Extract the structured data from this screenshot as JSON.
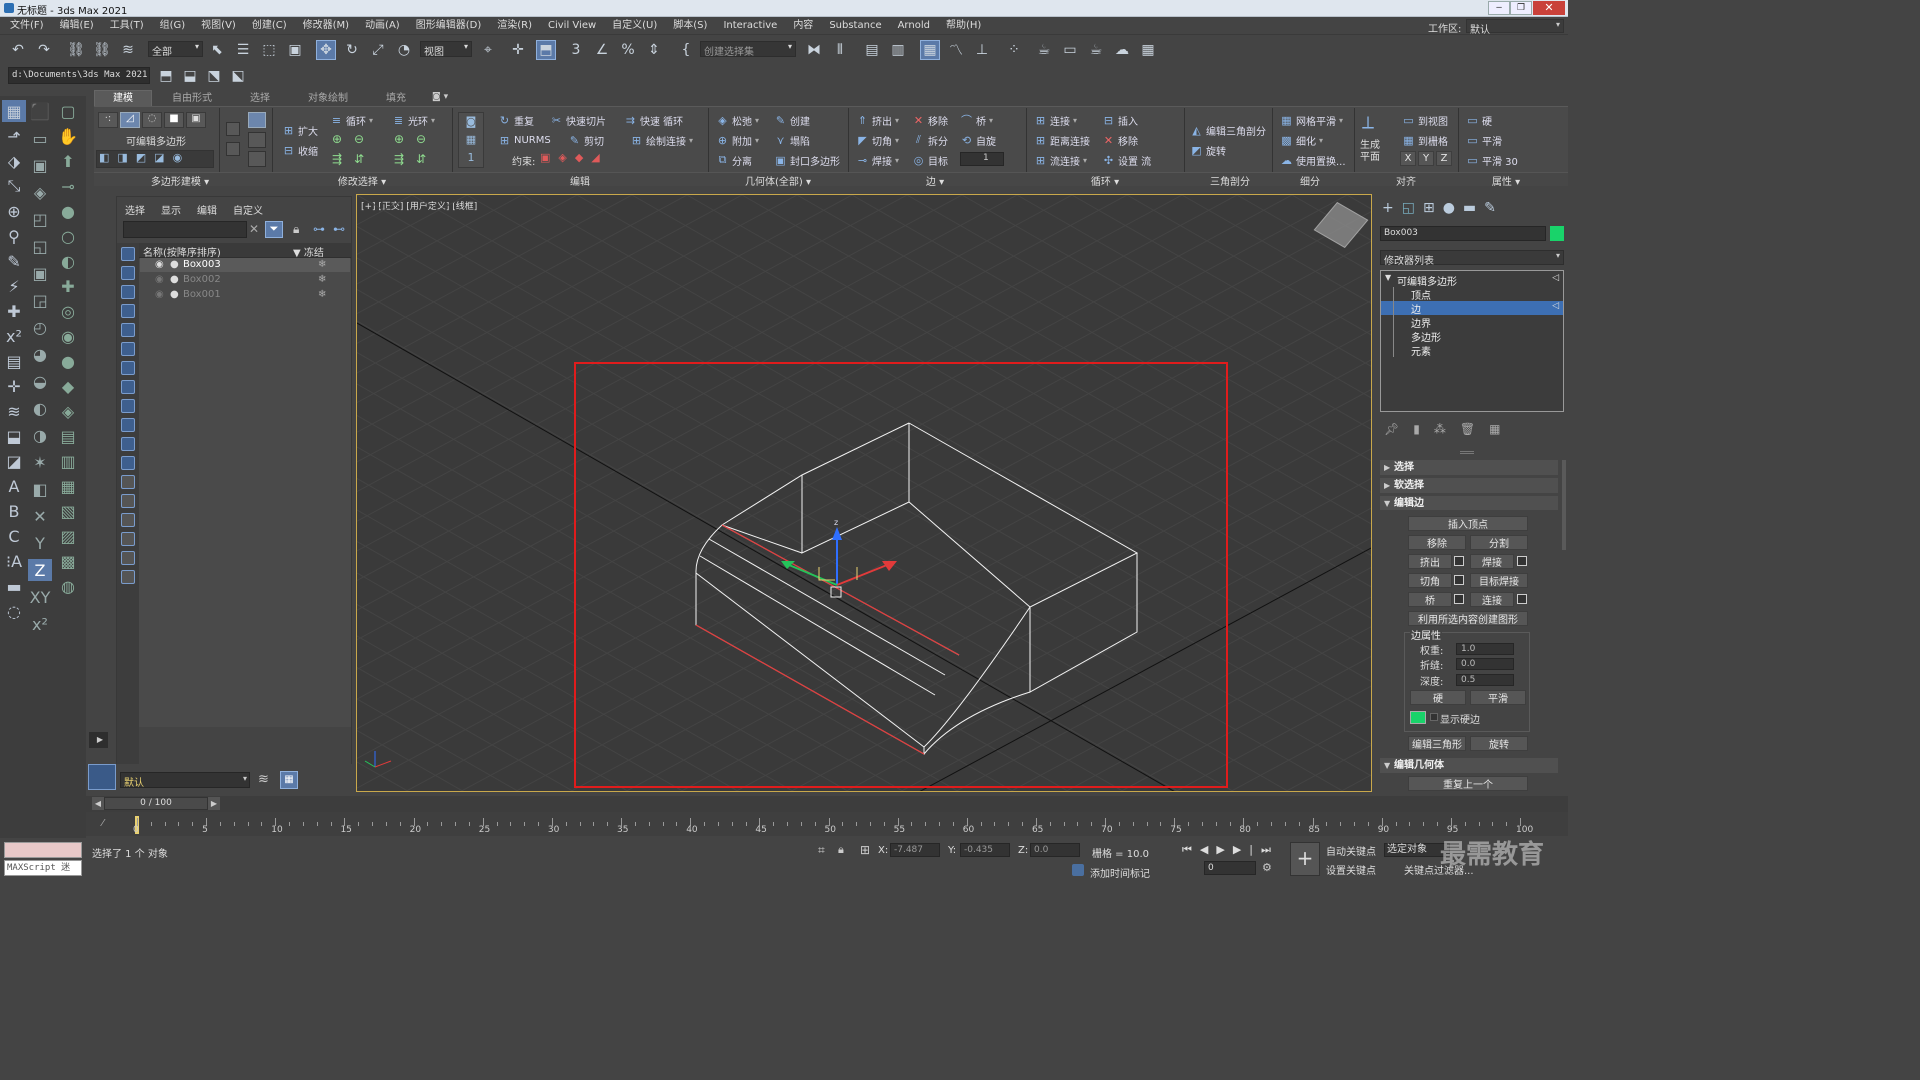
{
  "window": {
    "title": "无标题 - 3ds Max 2021"
  },
  "menu": [
    "文件(F)",
    "编辑(E)",
    "工具(T)",
    "组(G)",
    "视图(V)",
    "创建(C)",
    "修改器(M)",
    "动画(A)",
    "图形编辑器(D)",
    "渲染(R)",
    "Civil View",
    "自定义(U)",
    "脚本(S)",
    "Interactive",
    "内容",
    "Substance",
    "Arnold",
    "帮助(H)"
  ],
  "workspace": {
    "label": "工作区:",
    "value": "默认"
  },
  "toolbar": {
    "filter_value": "全部",
    "refcoord_value": "视图",
    "selection_set_placeholder": "创建选择集",
    "project_path": "d:\\Documents\\3ds Max 2021"
  },
  "ribbon": {
    "tabs": [
      "建模",
      "自由形式",
      "选择",
      "对象绘制",
      "填充"
    ],
    "active_tab": "建模",
    "groups": [
      "多边形建模",
      "修改选择",
      "编辑",
      "几何体(全部)",
      "边",
      "循环",
      "三角剖分",
      "细分",
      "对齐",
      "属性"
    ],
    "poly_label": "可编辑多边形",
    "modsel": [
      "扩大",
      "收缩",
      "循环",
      "光环"
    ],
    "edit": [
      "重复",
      "快速切片",
      "快速 循环",
      "NURMS",
      "剪切",
      "绘制连接",
      "约束:"
    ],
    "geom": [
      "松弛",
      "创建",
      "附加",
      "塌陷",
      "分离",
      "封口多边形"
    ],
    "edges": [
      "挤出",
      "移除",
      "桥",
      "切角",
      "拆分",
      "自旋",
      "焊接",
      "目标"
    ],
    "loops": [
      "连接",
      "插入",
      "距离连接",
      "移除",
      "流连接",
      "设置 流"
    ],
    "tri": [
      "编辑三角剖分",
      "旋转"
    ],
    "subdiv": [
      "网格平滑",
      "细化",
      "使用置换..."
    ],
    "align": [
      "生成平面",
      "到视图",
      "到栅格",
      "X",
      "Y",
      "Z"
    ],
    "props": [
      "硬",
      "平滑",
      "平滑 30"
    ]
  },
  "scene_explorer": {
    "tabs": [
      "选择",
      "显示",
      "编辑",
      "自定义"
    ],
    "col_name": "名称(按降序排序)",
    "col_freeze": "▼ 冻结",
    "rows": [
      "Box003",
      "Box002",
      "Box001"
    ],
    "layer": "默认"
  },
  "viewport": {
    "label": "[+] [正交] [用户定义] [线框]",
    "gizmo_z": "z"
  },
  "command_panel": {
    "object_name": "Box003",
    "modifier_list": "修改器列表",
    "stack": [
      "可编辑多边形",
      "顶点",
      "边",
      "边界",
      "多边形",
      "元素"
    ],
    "selected_level": "边",
    "rollouts": [
      "选择",
      "软选择",
      "编辑边"
    ],
    "edit_edges": {
      "insert_vertex": "插入顶点",
      "remove": "移除",
      "split": "分割",
      "extrude": "挤出",
      "weld": "焊接",
      "chamfer": "切角",
      "target_weld": "目标焊接",
      "bridge": "桥",
      "connect": "连接",
      "create_shape": "利用所选内容创建图形",
      "edge_props": "边属性",
      "weight_label": "权重:",
      "weight": "1.0",
      "crease_label": "折缝:",
      "crease": "0.0",
      "depth_label": "深度:",
      "depth": "0.5",
      "hard": "硬",
      "smooth": "平滑",
      "show_hard": "显示硬边",
      "edit_tri": "编辑三角形",
      "turn": "旋转"
    },
    "edit_geometry": "编辑几何体",
    "repeat_last": "重复上一个",
    "accent_green": "#19d36a"
  },
  "timeline": {
    "frame": "0 / 100",
    "ticks": [
      "0",
      "5",
      "10",
      "15",
      "20",
      "25",
      "30",
      "35",
      "40",
      "45",
      "50",
      "55",
      "60",
      "65",
      "70",
      "75",
      "80",
      "85",
      "90",
      "95",
      "100"
    ]
  },
  "status": {
    "maxscript": "MAXScript 迷",
    "selected": "选择了 1 个 对象",
    "x_label": "X:",
    "x": "-7.487",
    "y_label": "Y:",
    "y": "-0.435",
    "z_label": "Z:",
    "z": "0.0",
    "grid": "栅格 = 10.0",
    "add_time_tag": "添加时间标记",
    "auto_key": "自动关键点",
    "set_key": "设置关键点",
    "selected_obj": "选定对象",
    "key_filter": "关键点过滤器...",
    "frame_field": "0"
  },
  "watermark": "最需教育"
}
